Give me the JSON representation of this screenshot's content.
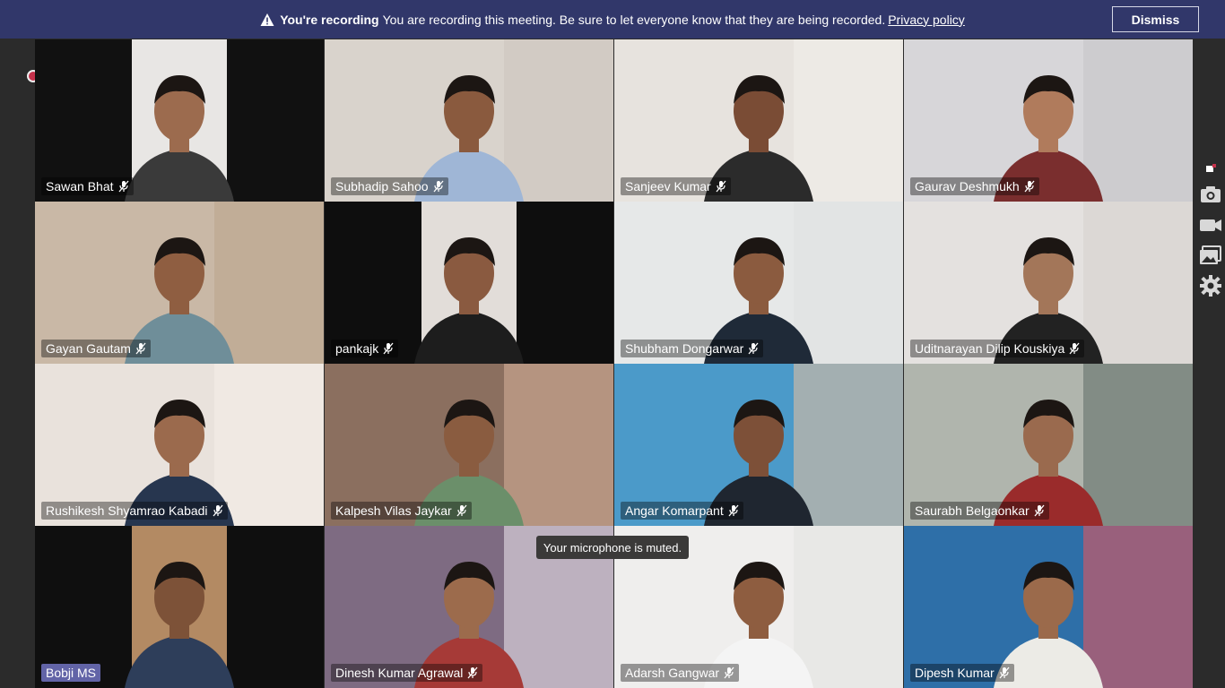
{
  "banner": {
    "title": "You're recording",
    "message": "You are recording this meeting. Be sure to let everyone know that they are being recorded.",
    "link": "Privacy policy",
    "dismiss": "Dismiss"
  },
  "tooltip": "Your microphone is muted.",
  "participants": [
    {
      "name": "Sawan Bhat",
      "bg": "#111111",
      "skin": "#9c6b4e",
      "shirt": "#3a3a3a",
      "wall": "#e8e6e4",
      "letterbox": true
    },
    {
      "name": "Subhadip Sahoo",
      "bg": "#d9d3cc",
      "skin": "#8a5a3e",
      "shirt": "#9fb6d6",
      "wall": "#cfc8c0"
    },
    {
      "name": "Sanjeev Kumar",
      "bg": "#e7e3de",
      "skin": "#7a4c35",
      "shirt": "#2b2b2b",
      "wall": "#f0ece8"
    },
    {
      "name": "Gaurav Deshmukh",
      "bg": "#d7d6d9",
      "skin": "#b07b5c",
      "shirt": "#7a2e2e",
      "wall": "#c9c8cb"
    },
    {
      "name": "Gayan Gautam",
      "bg": "#c9b8a6",
      "skin": "#8f5e41",
      "shirt": "#6f8e99",
      "wall": "#bda892"
    },
    {
      "name": "pankajk",
      "bg": "#0e0e0e",
      "skin": "#8a5a40",
      "shirt": "#1d1d1d",
      "wall": "#e2ddd9",
      "letterbox": true
    },
    {
      "name": "Shubham Dongarwar",
      "bg": "#e6e8e8",
      "skin": "#8b5b3f",
      "shirt": "#1f2a38",
      "wall": "#dfe3e3"
    },
    {
      "name": "Uditnarayan Dilip Kouskiya",
      "bg": "#e4e1df",
      "skin": "#a37659",
      "shirt": "#222222",
      "wall": "#d9d4d0"
    },
    {
      "name": "Rushikesh Shyamrao Kabadi",
      "bg": "#e9e2dc",
      "skin": "#9b6a4d",
      "shirt": "#27364f",
      "wall": "#f2ece6"
    },
    {
      "name": "Kalpesh Vilas Jaykar",
      "bg": "#8b6f5f",
      "skin": "#8a5c40",
      "shirt": "#6b8f6a",
      "wall": "#c7a48e"
    },
    {
      "name": "Angar Komarpant",
      "bg": "#4b9ac9",
      "skin": "#7d5038",
      "shirt": "#1f2630",
      "wall": "#c9b8a6"
    },
    {
      "name": "Saurabh Belgaonkar",
      "bg": "#b0b5ad",
      "skin": "#9a6a4e",
      "shirt": "#9a2b2b",
      "wall": "#6f7a74"
    },
    {
      "name": "Bobji MS",
      "bg": "#0f0f0f",
      "skin": "#7d5238",
      "shirt": "#2e3e5a",
      "wall": "#b38a63",
      "letterbox": true,
      "highlight": true
    },
    {
      "name": "Dinesh Kumar Agrawal",
      "bg": "#7e6b82",
      "skin": "#9c6b4c",
      "shirt": "#a63a37",
      "wall": "#d9cfd8"
    },
    {
      "name": "Adarsh Gangwar",
      "bg": "#efeeed",
      "skin": "#8e5d40",
      "shirt": "#f4f4f4",
      "wall": "#e6e5e3"
    },
    {
      "name": "Dipesh Kumar",
      "bg": "#2e6fa8",
      "skin": "#9b6a4b",
      "shirt": "#ecebe6",
      "wall": "#c85a69"
    }
  ],
  "sidebar": {
    "icons": [
      "pin-icon",
      "camera-icon",
      "video-icon",
      "image-icon",
      "gear-icon"
    ]
  },
  "colors": {
    "banner": "#31376a",
    "recording": "#c4314b",
    "highlight": "#6264a7"
  }
}
